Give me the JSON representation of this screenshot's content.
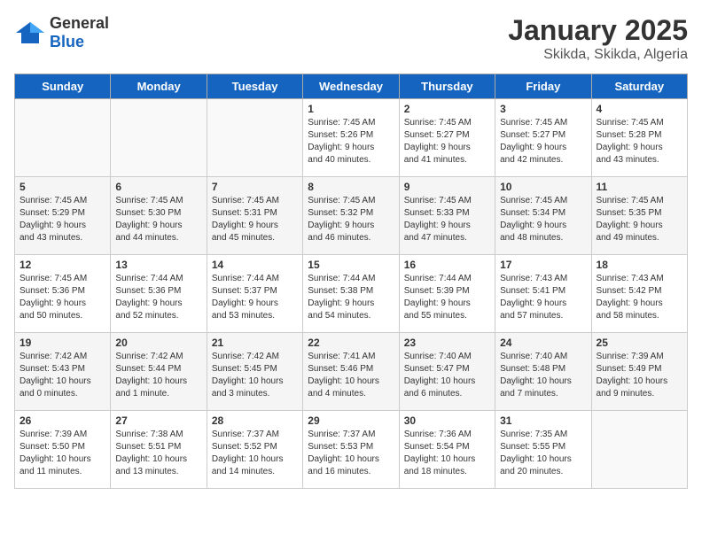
{
  "logo": {
    "general": "General",
    "blue": "Blue"
  },
  "header": {
    "month": "January 2025",
    "location": "Skikda, Skikda, Algeria"
  },
  "weekdays": [
    "Sunday",
    "Monday",
    "Tuesday",
    "Wednesday",
    "Thursday",
    "Friday",
    "Saturday"
  ],
  "weeks": [
    [
      {
        "day": "",
        "info": ""
      },
      {
        "day": "",
        "info": ""
      },
      {
        "day": "",
        "info": ""
      },
      {
        "day": "1",
        "info": "Sunrise: 7:45 AM\nSunset: 5:26 PM\nDaylight: 9 hours\nand 40 minutes."
      },
      {
        "day": "2",
        "info": "Sunrise: 7:45 AM\nSunset: 5:27 PM\nDaylight: 9 hours\nand 41 minutes."
      },
      {
        "day": "3",
        "info": "Sunrise: 7:45 AM\nSunset: 5:27 PM\nDaylight: 9 hours\nand 42 minutes."
      },
      {
        "day": "4",
        "info": "Sunrise: 7:45 AM\nSunset: 5:28 PM\nDaylight: 9 hours\nand 43 minutes."
      }
    ],
    [
      {
        "day": "5",
        "info": "Sunrise: 7:45 AM\nSunset: 5:29 PM\nDaylight: 9 hours\nand 43 minutes."
      },
      {
        "day": "6",
        "info": "Sunrise: 7:45 AM\nSunset: 5:30 PM\nDaylight: 9 hours\nand 44 minutes."
      },
      {
        "day": "7",
        "info": "Sunrise: 7:45 AM\nSunset: 5:31 PM\nDaylight: 9 hours\nand 45 minutes."
      },
      {
        "day": "8",
        "info": "Sunrise: 7:45 AM\nSunset: 5:32 PM\nDaylight: 9 hours\nand 46 minutes."
      },
      {
        "day": "9",
        "info": "Sunrise: 7:45 AM\nSunset: 5:33 PM\nDaylight: 9 hours\nand 47 minutes."
      },
      {
        "day": "10",
        "info": "Sunrise: 7:45 AM\nSunset: 5:34 PM\nDaylight: 9 hours\nand 48 minutes."
      },
      {
        "day": "11",
        "info": "Sunrise: 7:45 AM\nSunset: 5:35 PM\nDaylight: 9 hours\nand 49 minutes."
      }
    ],
    [
      {
        "day": "12",
        "info": "Sunrise: 7:45 AM\nSunset: 5:36 PM\nDaylight: 9 hours\nand 50 minutes."
      },
      {
        "day": "13",
        "info": "Sunrise: 7:44 AM\nSunset: 5:36 PM\nDaylight: 9 hours\nand 52 minutes."
      },
      {
        "day": "14",
        "info": "Sunrise: 7:44 AM\nSunset: 5:37 PM\nDaylight: 9 hours\nand 53 minutes."
      },
      {
        "day": "15",
        "info": "Sunrise: 7:44 AM\nSunset: 5:38 PM\nDaylight: 9 hours\nand 54 minutes."
      },
      {
        "day": "16",
        "info": "Sunrise: 7:44 AM\nSunset: 5:39 PM\nDaylight: 9 hours\nand 55 minutes."
      },
      {
        "day": "17",
        "info": "Sunrise: 7:43 AM\nSunset: 5:41 PM\nDaylight: 9 hours\nand 57 minutes."
      },
      {
        "day": "18",
        "info": "Sunrise: 7:43 AM\nSunset: 5:42 PM\nDaylight: 9 hours\nand 58 minutes."
      }
    ],
    [
      {
        "day": "19",
        "info": "Sunrise: 7:42 AM\nSunset: 5:43 PM\nDaylight: 10 hours\nand 0 minutes."
      },
      {
        "day": "20",
        "info": "Sunrise: 7:42 AM\nSunset: 5:44 PM\nDaylight: 10 hours\nand 1 minute."
      },
      {
        "day": "21",
        "info": "Sunrise: 7:42 AM\nSunset: 5:45 PM\nDaylight: 10 hours\nand 3 minutes."
      },
      {
        "day": "22",
        "info": "Sunrise: 7:41 AM\nSunset: 5:46 PM\nDaylight: 10 hours\nand 4 minutes."
      },
      {
        "day": "23",
        "info": "Sunrise: 7:40 AM\nSunset: 5:47 PM\nDaylight: 10 hours\nand 6 minutes."
      },
      {
        "day": "24",
        "info": "Sunrise: 7:40 AM\nSunset: 5:48 PM\nDaylight: 10 hours\nand 7 minutes."
      },
      {
        "day": "25",
        "info": "Sunrise: 7:39 AM\nSunset: 5:49 PM\nDaylight: 10 hours\nand 9 minutes."
      }
    ],
    [
      {
        "day": "26",
        "info": "Sunrise: 7:39 AM\nSunset: 5:50 PM\nDaylight: 10 hours\nand 11 minutes."
      },
      {
        "day": "27",
        "info": "Sunrise: 7:38 AM\nSunset: 5:51 PM\nDaylight: 10 hours\nand 13 minutes."
      },
      {
        "day": "28",
        "info": "Sunrise: 7:37 AM\nSunset: 5:52 PM\nDaylight: 10 hours\nand 14 minutes."
      },
      {
        "day": "29",
        "info": "Sunrise: 7:37 AM\nSunset: 5:53 PM\nDaylight: 10 hours\nand 16 minutes."
      },
      {
        "day": "30",
        "info": "Sunrise: 7:36 AM\nSunset: 5:54 PM\nDaylight: 10 hours\nand 18 minutes."
      },
      {
        "day": "31",
        "info": "Sunrise: 7:35 AM\nSunset: 5:55 PM\nDaylight: 10 hours\nand 20 minutes."
      },
      {
        "day": "",
        "info": ""
      }
    ]
  ]
}
